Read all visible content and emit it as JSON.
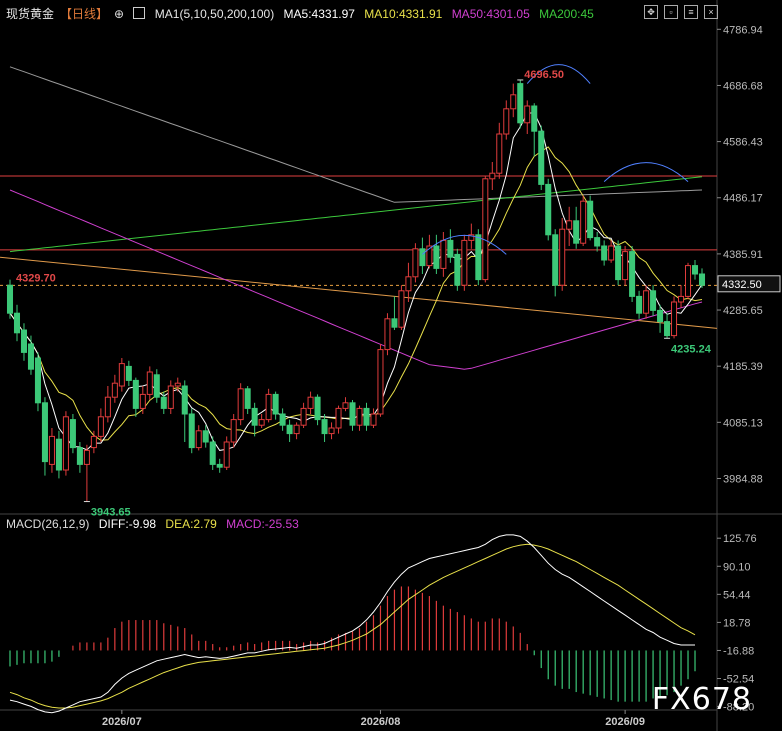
{
  "header": {
    "symbol": "现货黄金",
    "timeframe": "【日线】",
    "circle_icon": "⊕",
    "ma_params": "MA1(5,10,50,200,100)",
    "ma5": "MA5:4331.97",
    "ma10": "MA10:4331.91",
    "ma50": "MA50:4301.05",
    "ma200": "MA200:45"
  },
  "macd_header": {
    "name": "MACD(26,12,9)",
    "diff": "DIFF:-9.98",
    "dea": "DEA:2.79",
    "macd": "MACD:-25.53"
  },
  "watermark": "FX678",
  "colors": {
    "up": "#e03c3c",
    "down": "#3cc878",
    "ma5": "#ffffff",
    "ma10": "#e8e04a",
    "ma50": "#d040d0",
    "ma200": "#3cc83c",
    "ma100": "#9a9a9a",
    "hline": "#e04040",
    "trend": "#e09a4a",
    "arc": "#5080ff",
    "current": "#e8a040"
  },
  "chart_data": {
    "type": "candlestick",
    "price_axis": {
      "range": [
        3925,
        4800
      ],
      "ticks": [
        4786.94,
        4686.68,
        4586.43,
        4486.17,
        4385.91,
        4285.65,
        4185.39,
        4085.13,
        3984.88
      ]
    },
    "current_price": "4332.50",
    "reference_price": "4329.70",
    "annotations": [
      {
        "label": "4696.50",
        "value": 4696.5,
        "kind": "high"
      },
      {
        "label": "4235.24",
        "value": 4235.24,
        "kind": "low"
      },
      {
        "label": "3943.65",
        "value": 3943.65,
        "kind": "low"
      }
    ],
    "x_labels": [
      {
        "label": "2026/07",
        "index": 16
      },
      {
        "label": "2026/08",
        "index": 53
      },
      {
        "label": "2026/09",
        "index": 88
      }
    ],
    "horizontal_lines": [
      4525,
      4393
    ],
    "candles": [
      [
        4330,
        4280,
        4340,
        4270
      ],
      [
        4280,
        4245,
        4295,
        4230
      ],
      [
        4250,
        4210,
        4262,
        4195
      ],
      [
        4225,
        4180,
        4240,
        4170
      ],
      [
        4200,
        4120,
        4210,
        4105
      ],
      [
        4120,
        4015,
        4130,
        3990
      ],
      [
        4010,
        4060,
        4075,
        3995
      ],
      [
        4055,
        4000,
        4070,
        3985
      ],
      [
        4000,
        4095,
        4105,
        3990
      ],
      [
        4090,
        4040,
        4100,
        4030
      ],
      [
        4040,
        4010,
        4050,
        3995
      ],
      [
        4010,
        4035,
        4045,
        3943.65
      ],
      [
        4040,
        4060,
        4070,
        4030
      ],
      [
        4060,
        4095,
        4110,
        4050
      ],
      [
        4095,
        4130,
        4150,
        4085
      ],
      [
        4130,
        4155,
        4170,
        4120
      ],
      [
        4150,
        4190,
        4200,
        4140
      ],
      [
        4185,
        4160,
        4195,
        4150
      ],
      [
        4160,
        4110,
        4165,
        4095
      ],
      [
        4110,
        4135,
        4150,
        4100
      ],
      [
        4135,
        4175,
        4185,
        4125
      ],
      [
        4170,
        4130,
        4180,
        4120
      ],
      [
        4130,
        4110,
        4140,
        4100
      ],
      [
        4110,
        4150,
        4160,
        4100
      ],
      [
        4150,
        4155,
        4165,
        4140
      ],
      [
        4150,
        4100,
        4160,
        4050
      ],
      [
        4100,
        4040,
        4110,
        4030
      ],
      [
        4040,
        4070,
        4080,
        4035
      ],
      [
        4070,
        4050,
        4080,
        4040
      ],
      [
        4050,
        4010,
        4060,
        4000
      ],
      [
        4010,
        4005,
        4020,
        3995
      ],
      [
        4005,
        4050,
        4060,
        4000
      ],
      [
        4050,
        4090,
        4100,
        4040
      ],
      [
        4090,
        4145,
        4155,
        4080
      ],
      [
        4145,
        4110,
        4150,
        4100
      ],
      [
        4110,
        4080,
        4120,
        4060
      ],
      [
        4080,
        4090,
        4100,
        4075
      ],
      [
        4090,
        4135,
        4145,
        4085
      ],
      [
        4135,
        4100,
        4140,
        4090
      ],
      [
        4100,
        4080,
        4110,
        4070
      ],
      [
        4080,
        4065,
        4090,
        4050
      ],
      [
        4065,
        4080,
        4085,
        4055
      ],
      [
        4080,
        4110,
        4120,
        4075
      ],
      [
        4110,
        4130,
        4140,
        4100
      ],
      [
        4130,
        4090,
        4135,
        4080
      ],
      [
        4090,
        4065,
        4100,
        4050
      ],
      [
        4065,
        4075,
        4085,
        4055
      ],
      [
        4075,
        4110,
        4115,
        4065
      ],
      [
        4110,
        4120,
        4130,
        4105
      ],
      [
        4120,
        4080,
        4125,
        4070
      ],
      [
        4080,
        4110,
        4115,
        4070
      ],
      [
        4110,
        4080,
        4120,
        4070
      ],
      [
        4080,
        4100,
        4110,
        4075
      ],
      [
        4100,
        4215,
        4225,
        4095
      ],
      [
        4215,
        4270,
        4280,
        4205
      ],
      [
        4270,
        4255,
        4310,
        4250
      ],
      [
        4255,
        4320,
        4330,
        4250
      ],
      [
        4320,
        4345,
        4370,
        4300
      ],
      [
        4345,
        4395,
        4405,
        4335
      ],
      [
        4395,
        4365,
        4415,
        4350
      ],
      [
        4365,
        4400,
        4420,
        4360
      ],
      [
        4400,
        4360,
        4420,
        4350
      ],
      [
        4360,
        4410,
        4425,
        4345
      ],
      [
        4410,
        4380,
        4430,
        4370
      ],
      [
        4385,
        4330,
        4395,
        4320
      ],
      [
        4330,
        4410,
        4420,
        4320
      ],
      [
        4410,
        4420,
        4440,
        4395
      ],
      [
        4420,
        4340,
        4430,
        4330
      ],
      [
        4340,
        4520,
        4525,
        4335
      ],
      [
        4520,
        4530,
        4550,
        4500
      ],
      [
        4530,
        4600,
        4620,
        4520
      ],
      [
        4600,
        4645,
        4660,
        4590
      ],
      [
        4645,
        4670,
        4690,
        4630
      ],
      [
        4690,
        4620,
        4696.5,
        4610
      ],
      [
        4620,
        4650,
        4660,
        4600
      ],
      [
        4650,
        4605,
        4655,
        4560
      ],
      [
        4605,
        4510,
        4615,
        4500
      ],
      [
        4510,
        4420,
        4520,
        4410
      ],
      [
        4420,
        4330,
        4430,
        4310
      ],
      [
        4330,
        4430,
        4450,
        4320
      ],
      [
        4430,
        4445,
        4470,
        4400
      ],
      [
        4445,
        4405,
        4470,
        4395
      ],
      [
        4405,
        4480,
        4490,
        4400
      ],
      [
        4480,
        4415,
        4490,
        4410
      ],
      [
        4415,
        4400,
        4425,
        4390
      ],
      [
        4400,
        4375,
        4410,
        4365
      ],
      [
        4375,
        4400,
        4410,
        4370
      ],
      [
        4400,
        4340,
        4410,
        4330
      ],
      [
        4340,
        4390,
        4400,
        4330
      ],
      [
        4390,
        4310,
        4400,
        4300
      ],
      [
        4310,
        4280,
        4320,
        4270
      ],
      [
        4280,
        4320,
        4330,
        4270
      ],
      [
        4320,
        4285,
        4330,
        4275
      ],
      [
        4285,
        4265,
        4295,
        4245
      ],
      [
        4265,
        4240,
        4280,
        4235.24
      ],
      [
        4240,
        4300,
        4310,
        4235
      ],
      [
        4300,
        4310,
        4330,
        4290
      ],
      [
        4310,
        4365,
        4370,
        4305
      ],
      [
        4365,
        4350,
        4375,
        4340
      ],
      [
        4350,
        4330,
        4360,
        4325
      ]
    ],
    "macd": {
      "range": [
        -90,
        140
      ],
      "ticks": [
        125.76,
        90.1,
        54.44,
        18.78,
        -16.88,
        -52.54,
        -88.2
      ],
      "diff": [
        -80,
        -82,
        -85,
        -88,
        -92,
        -95,
        -96,
        -94,
        -90,
        -86,
        -82,
        -80,
        -78,
        -76,
        -70,
        -60,
        -52,
        -46,
        -42,
        -38,
        -34,
        -30,
        -28,
        -26,
        -24,
        -22,
        -24,
        -26,
        -25,
        -26,
        -27,
        -26,
        -24,
        -22,
        -20,
        -20,
        -18,
        -16,
        -15,
        -14,
        -13,
        -14,
        -12,
        -10,
        -10,
        -8,
        -4,
        0,
        4,
        8,
        14,
        22,
        32,
        44,
        58,
        70,
        80,
        88,
        92,
        96,
        100,
        102,
        104,
        106,
        108,
        110,
        112,
        114,
        118,
        124,
        128,
        130,
        130,
        128,
        122,
        114,
        104,
        94,
        86,
        80,
        76,
        70,
        64,
        58,
        52,
        46,
        40,
        34,
        28,
        22,
        16,
        10,
        6,
        0,
        -4,
        -8,
        -10,
        -10,
        -10
      ],
      "dea": [
        -70,
        -73,
        -77,
        -80,
        -84,
        -87,
        -89,
        -90,
        -90,
        -89,
        -87,
        -85,
        -83,
        -81,
        -78,
        -74,
        -70,
        -65,
        -61,
        -57,
        -53,
        -49,
        -45,
        -42,
        -39,
        -36,
        -34,
        -32,
        -31,
        -30,
        -29,
        -28,
        -27,
        -26,
        -25,
        -24,
        -23,
        -22,
        -21,
        -20,
        -19,
        -18,
        -17,
        -16,
        -15,
        -14,
        -12,
        -10,
        -7,
        -4,
        0,
        4,
        10,
        16,
        24,
        32,
        40,
        48,
        54,
        60,
        66,
        71,
        76,
        80,
        84,
        88,
        92,
        96,
        100,
        104,
        108,
        112,
        115,
        117,
        118,
        117,
        115,
        112,
        108,
        104,
        100,
        96,
        91,
        86,
        81,
        76,
        71,
        66,
        60,
        54,
        48,
        42,
        36,
        30,
        24,
        18,
        12,
        8,
        3
      ],
      "macd_bars": [
        -10,
        -9,
        -8,
        -8,
        -8,
        -8,
        -7,
        -4,
        0,
        3,
        5,
        5,
        5,
        5,
        8,
        14,
        18,
        19,
        19,
        19,
        19,
        19,
        17,
        16,
        15,
        14,
        10,
        6,
        6,
        4,
        2,
        2,
        3,
        4,
        5,
        4,
        5,
        6,
        6,
        6,
        6,
        4,
        5,
        6,
        5,
        6,
        8,
        10,
        11,
        12,
        14,
        18,
        22,
        28,
        34,
        38,
        40,
        40,
        38,
        36,
        34,
        31,
        28,
        26,
        24,
        22,
        20,
        18,
        18,
        20,
        20,
        18,
        15,
        11,
        4,
        -3,
        -11,
        -18,
        -22,
        -24,
        -24,
        -26,
        -27,
        -28,
        -29,
        -30,
        -31,
        -32,
        -32,
        -32,
        -32,
        -32,
        -30,
        -30,
        -28,
        -26,
        -22,
        -18,
        -13
      ]
    }
  }
}
